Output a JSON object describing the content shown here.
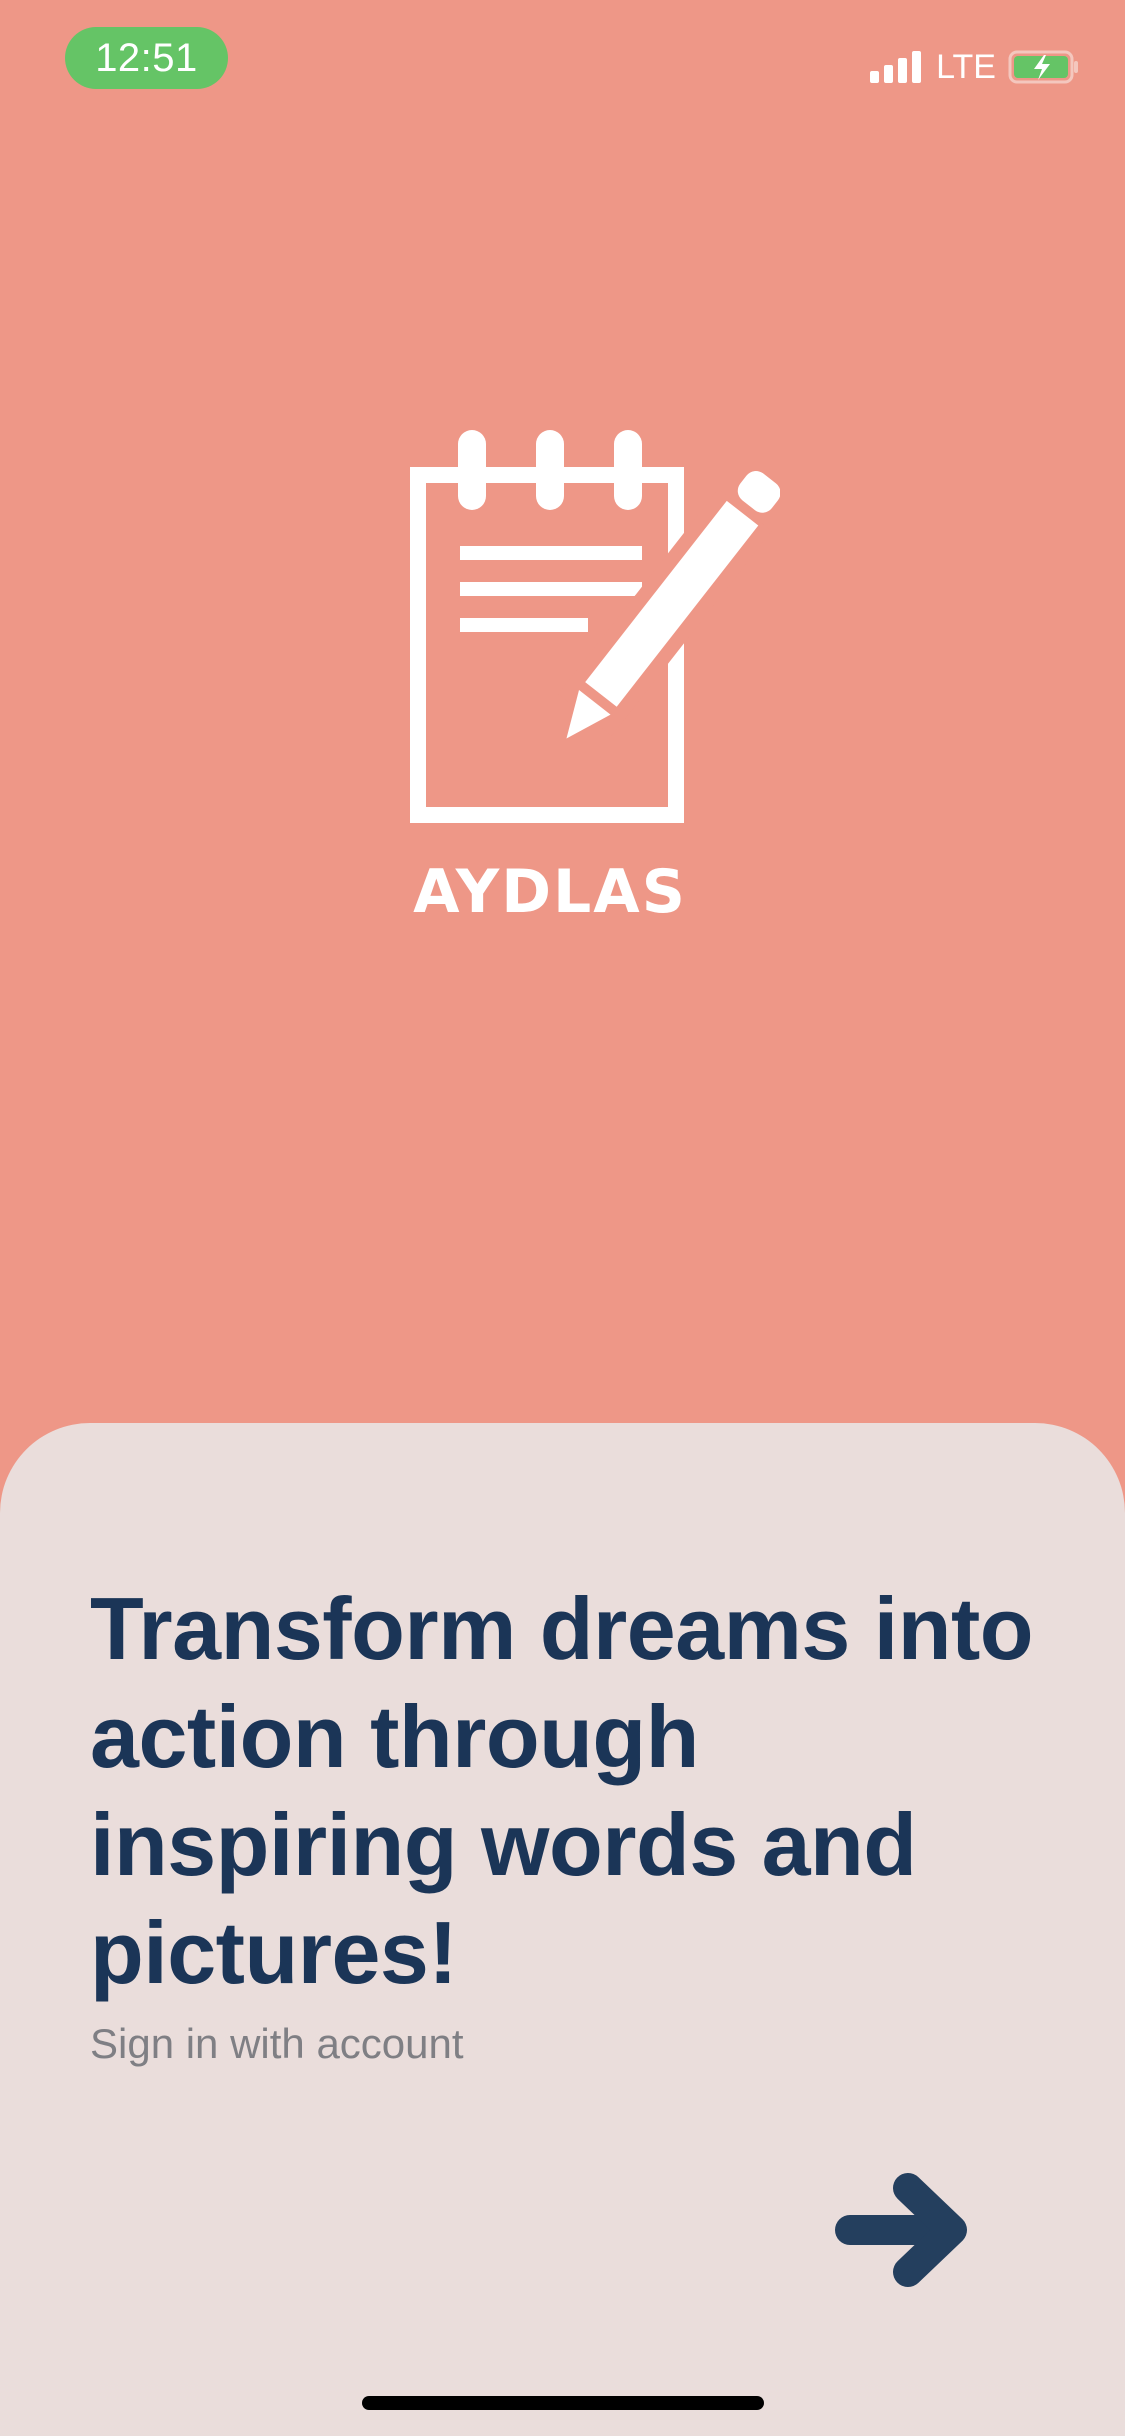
{
  "status_bar": {
    "time": "12:51",
    "network": "LTE",
    "icons": [
      "signal-bars-icon",
      "battery-charging-icon"
    ]
  },
  "brand": {
    "name": "AYDLAS",
    "logo_icon": "notepad-pencil-icon"
  },
  "onboarding": {
    "headline": "Transform dreams into action through inspiring words and pictures!",
    "signin_label": "Sign in with account",
    "next_icon": "arrow-right-icon"
  },
  "colors": {
    "background": "#EE9787",
    "sheet": "#EADDDB",
    "headline": "#1B3557",
    "subtext": "#7F7F84",
    "time_pill": "#65C466",
    "arrow": "#243F5E"
  }
}
